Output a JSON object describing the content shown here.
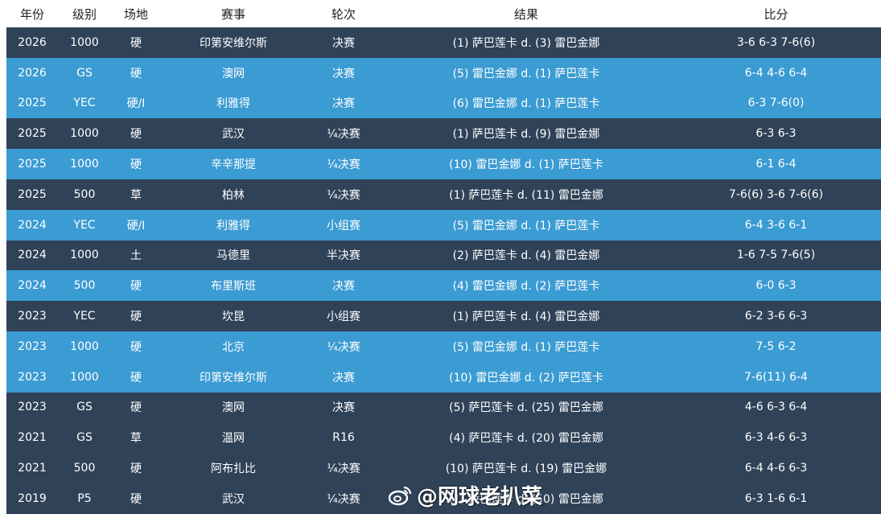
{
  "header": {
    "year": "年份",
    "level": "级别",
    "surface": "场地",
    "event": "赛事",
    "round": "轮次",
    "result": "结果",
    "score": "比分"
  },
  "rows": [
    {
      "year": "2026",
      "level": "1000",
      "surface": "硬",
      "event": "印第安维尔斯",
      "round": "决赛",
      "result": "(1) 萨巴莲卡 d. (3) 雷巴金娜",
      "score": "3-6 6-3 7-6(6)"
    },
    {
      "year": "2026",
      "level": "GS",
      "surface": "硬",
      "event": "澳网",
      "round": "决赛",
      "result": "(5) 雷巴金娜 d. (1) 萨巴莲卡",
      "score": "6-4 4-6 6-4"
    },
    {
      "year": "2025",
      "level": "YEC",
      "surface": "硬/I",
      "event": "利雅得",
      "round": "决赛",
      "result": "(6) 雷巴金娜 d. (1) 萨巴莲卡",
      "score": "6-3 7-6(0)"
    },
    {
      "year": "2025",
      "level": "1000",
      "surface": "硬",
      "event": "武汉",
      "round": "¼决赛",
      "result": "(1) 萨巴莲卡 d. (9) 雷巴金娜",
      "score": "6-3 6-3"
    },
    {
      "year": "2025",
      "level": "1000",
      "surface": "硬",
      "event": "辛辛那提",
      "round": "¼决赛",
      "result": "(10) 雷巴金娜 d. (1) 萨巴莲卡",
      "score": "6-1 6-4"
    },
    {
      "year": "2025",
      "level": "500",
      "surface": "草",
      "event": "柏林",
      "round": "¼决赛",
      "result": "(1) 萨巴莲卡 d. (11) 雷巴金娜",
      "score": "7-6(6) 3-6 7-6(6)"
    },
    {
      "year": "2024",
      "level": "YEC",
      "surface": "硬/I",
      "event": "利雅得",
      "round": "小组赛",
      "result": "(5) 雷巴金娜 d. (1) 萨巴莲卡",
      "score": "6-4 3-6 6-1"
    },
    {
      "year": "2024",
      "level": "1000",
      "surface": "土",
      "event": "马德里",
      "round": "半决赛",
      "result": "(2) 萨巴莲卡 d. (4) 雷巴金娜",
      "score": "1-6 7-5 7-6(5)"
    },
    {
      "year": "2024",
      "level": "500",
      "surface": "硬",
      "event": "布里斯班",
      "round": "决赛",
      "result": "(4) 雷巴金娜 d. (2) 萨巴莲卡",
      "score": "6-0 6-3"
    },
    {
      "year": "2023",
      "level": "YEC",
      "surface": "硬",
      "event": "坎昆",
      "round": "小组赛",
      "result": "(1) 萨巴莲卡 d. (4) 雷巴金娜",
      "score": "6-2 3-6 6-3"
    },
    {
      "year": "2023",
      "level": "1000",
      "surface": "硬",
      "event": "北京",
      "round": "¼决赛",
      "result": "(5) 雷巴金娜 d. (1) 萨巴莲卡",
      "score": "7-5 6-2"
    },
    {
      "year": "2023",
      "level": "1000",
      "surface": "硬",
      "event": "印第安维尔斯",
      "round": "决赛",
      "result": "(10) 雷巴金娜 d. (2) 萨巴莲卡",
      "score": "7-6(11) 6-4"
    },
    {
      "year": "2023",
      "level": "GS",
      "surface": "硬",
      "event": "澳网",
      "round": "决赛",
      "result": "(5) 萨巴莲卡 d. (25) 雷巴金娜",
      "score": "4-6 6-3 6-4"
    },
    {
      "year": "2021",
      "level": "GS",
      "surface": "草",
      "event": "温网",
      "round": "R16",
      "result": "(4) 萨巴莲卡 d. (20) 雷巴金娜",
      "score": "6-3 4-6 6-3"
    },
    {
      "year": "2021",
      "level": "500",
      "surface": "硬",
      "event": "阿布扎比",
      "round": "¼决赛",
      "result": "(10) 萨巴莲卡 d. (19) 雷巴金娜",
      "score": "6-4 4-6 6-3"
    },
    {
      "year": "2019",
      "level": "P5",
      "surface": "硬",
      "event": "武汉",
      "round": "¼决赛",
      "result": "(1) 萨巴莲卡 d. (50) 雷巴金娜",
      "score": "6-3 1-6 6-1"
    }
  ],
  "row_colors": [
    "#2f4258",
    "#3b9bd3",
    "#3b9bd3",
    "#2f4258",
    "#3b9bd3",
    "#2f4258",
    "#3b9bd3",
    "#2f4258",
    "#3b9bd3",
    "#2f4258",
    "#3b9bd3",
    "#3b9bd3",
    "#2f4258",
    "#2f4258",
    "#2f4258",
    "#2f4258"
  ],
  "watermark": {
    "icon": "weibo-icon",
    "text": "@网球老扒菜"
  }
}
